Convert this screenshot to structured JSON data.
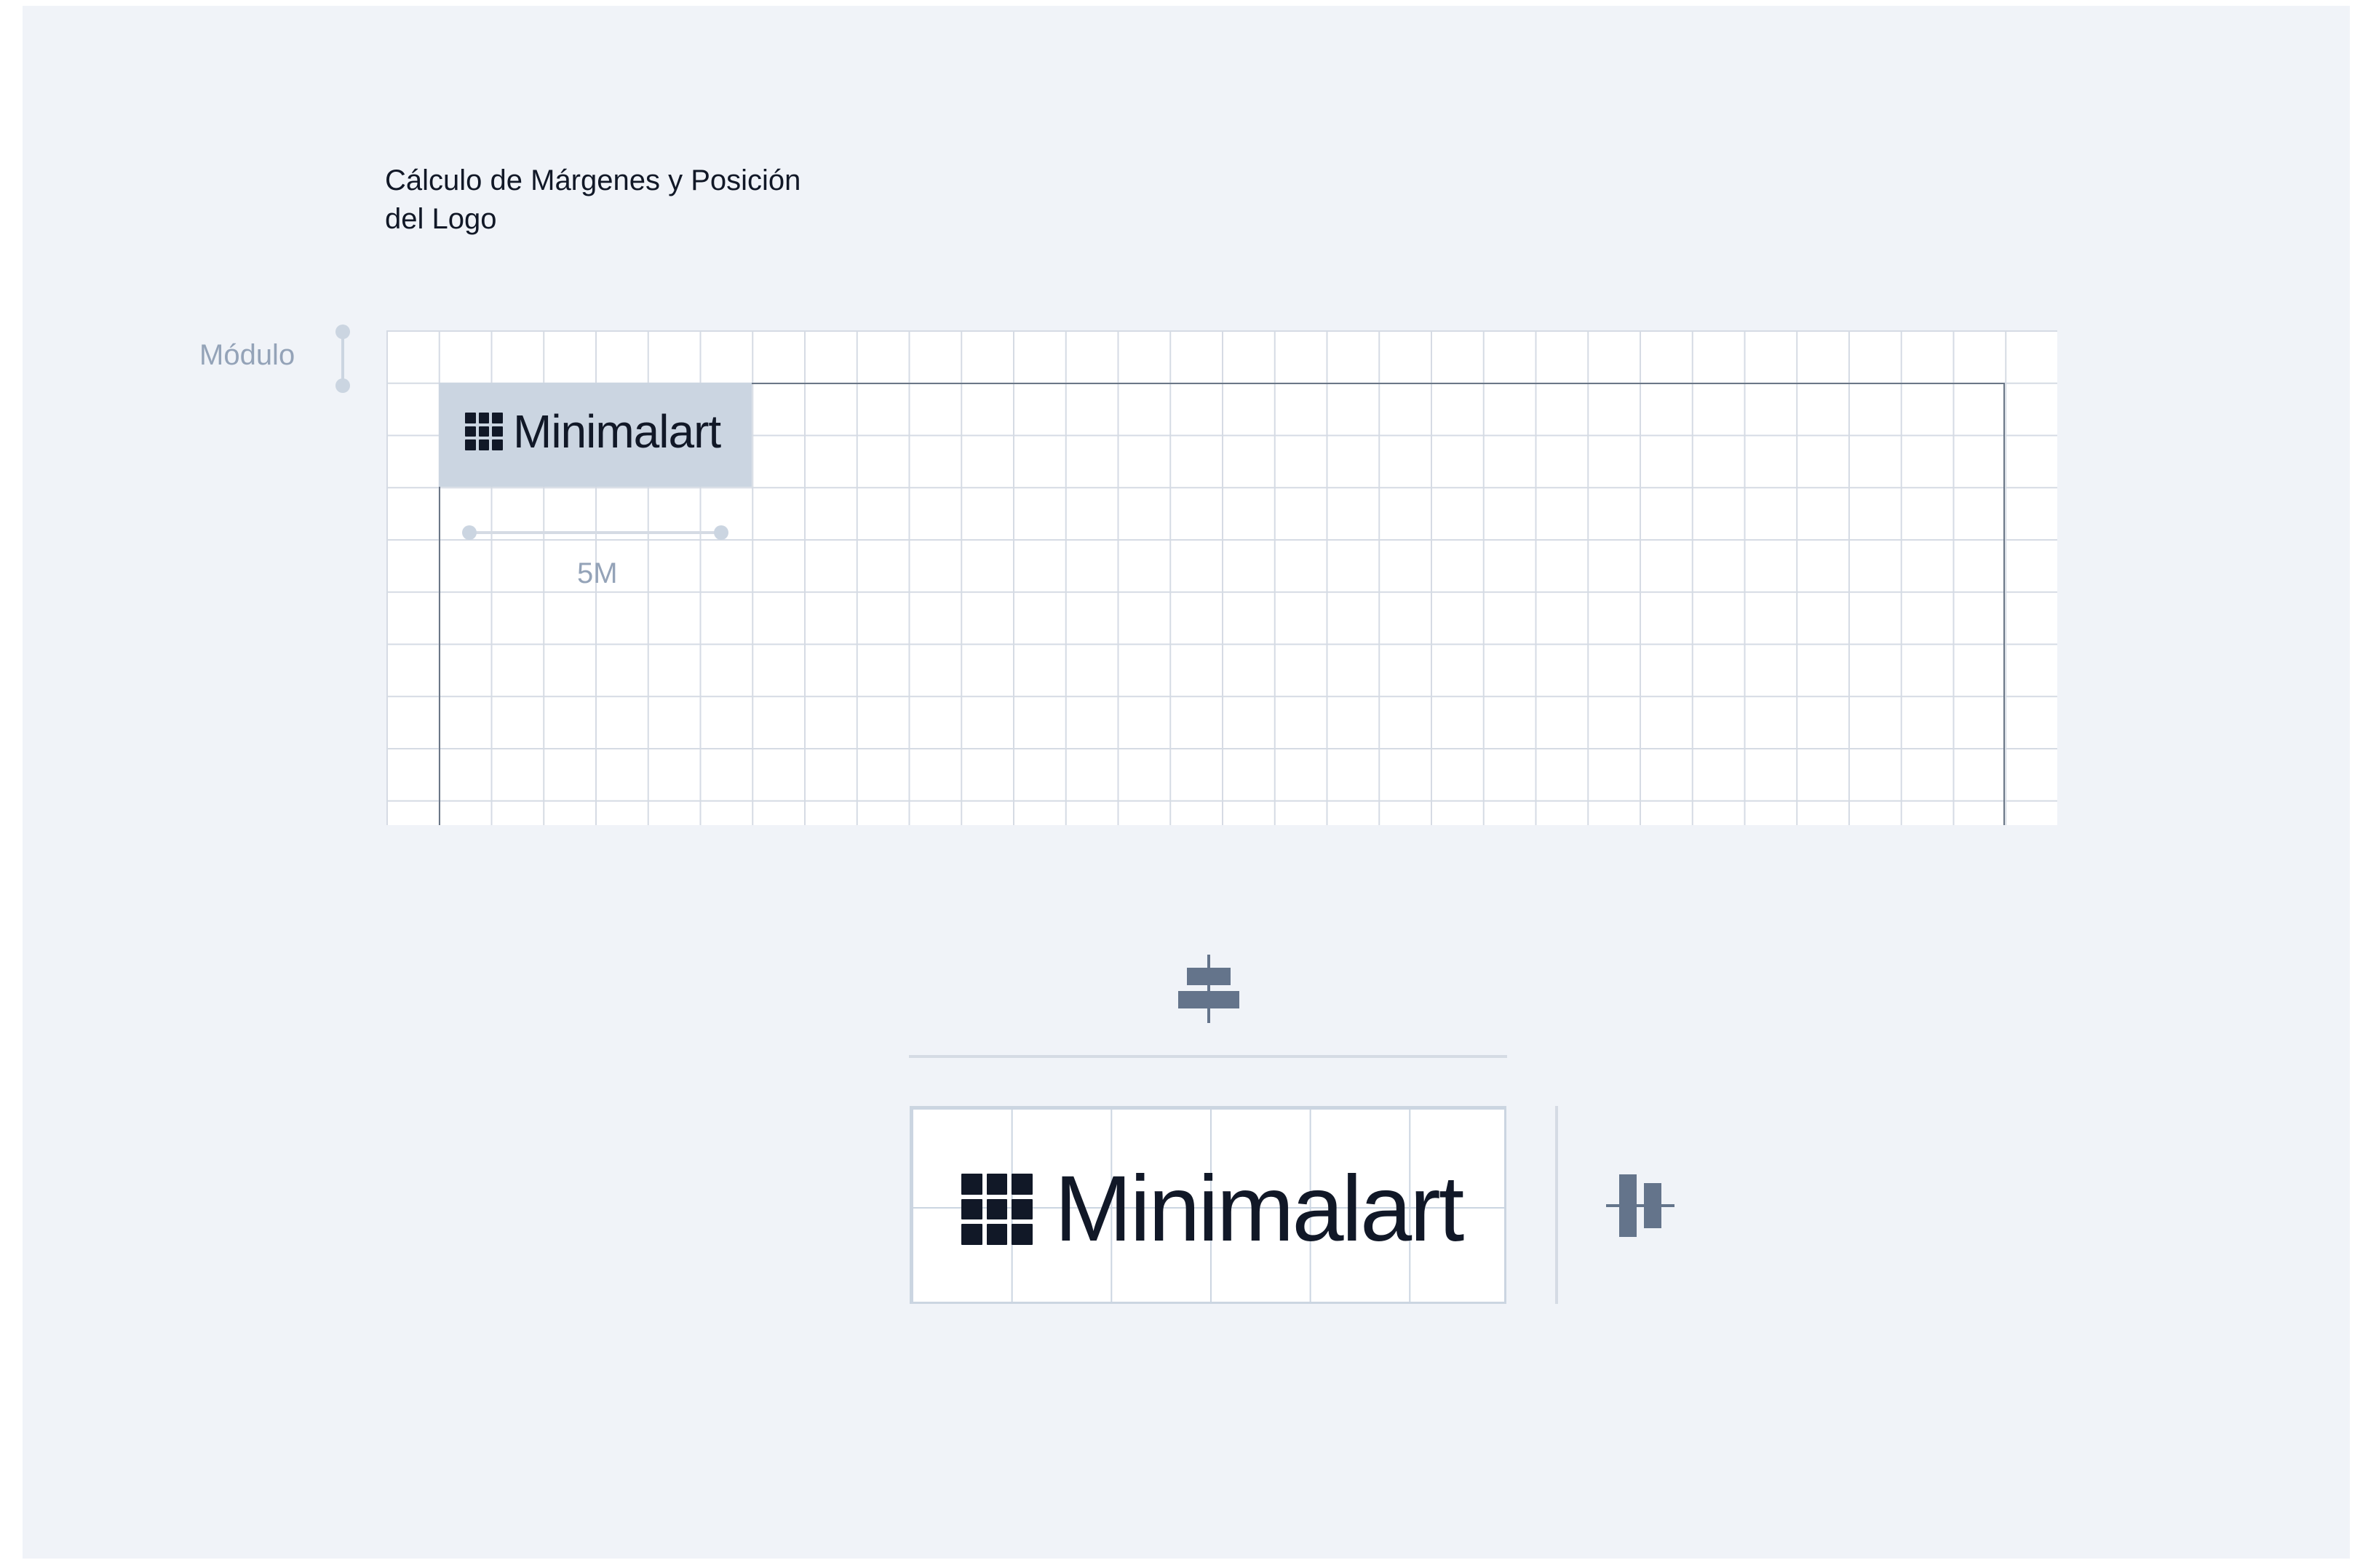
{
  "title": "Cálculo de Márgenes y Posición del Logo",
  "module_label": "Módulo",
  "measure_label": "5M",
  "logo": {
    "wordmark": "Minimalart",
    "mark_icon": "grid-mark-icon"
  },
  "icons": {
    "align_horizontal": "align-center-horizontal-icon",
    "align_vertical": "align-center-vertical-icon"
  },
  "colors": {
    "background": "#f0f3f8",
    "grid_line": "#d5dbe4",
    "logo_cell": "#cbd5e1",
    "ink": "#111827",
    "muted": "#94a3b8",
    "icon": "#64748b"
  }
}
